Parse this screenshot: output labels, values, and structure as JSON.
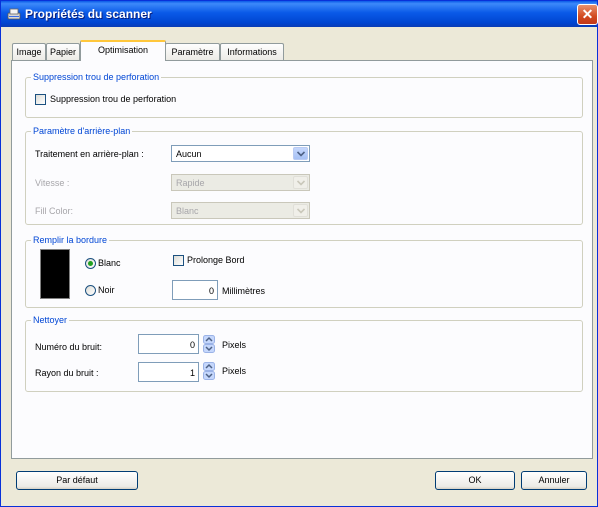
{
  "window": {
    "title": "Propriétés du scanner",
    "close_symbol": "✕"
  },
  "tabs": [
    {
      "label": "Image",
      "active": false
    },
    {
      "label": "Papier",
      "active": false
    },
    {
      "label": "Optimisation",
      "active": true
    },
    {
      "label": "Paramètre",
      "active": false
    },
    {
      "label": "Informations",
      "active": false
    }
  ],
  "hole_removal": {
    "title": "Suppression trou de perforation",
    "checkbox_label": "Suppression trou de perforation",
    "checked": false
  },
  "background": {
    "title": "Paramètre d'arrière-plan",
    "treatment_label": "Traitement en arrière-plan :",
    "treatment_value": "Aucun",
    "speed_label": "Vitesse :",
    "speed_value": "Rapide",
    "fill_label": "Fill Color:",
    "fill_value": "Blanc"
  },
  "border": {
    "title": "Remplir la bordure",
    "white_label": "Blanc",
    "white_selected": true,
    "black_label": "Noir",
    "black_selected": false,
    "extend_label": "Prolonge Bord",
    "extend_checked": false,
    "mm_value": "0",
    "mm_label": "Millimètres"
  },
  "clean": {
    "title": "Nettoyer",
    "noise_number_label": "Numéro du bruit:",
    "noise_number_value": "0",
    "noise_radius_label": "Rayon du bruit :",
    "noise_radius_value": "1",
    "unit_label": "Pixels"
  },
  "buttons": {
    "default_label": "Par défaut",
    "ok_label": "OK",
    "cancel_label": "Annuler"
  },
  "colors": {
    "group_title": "#0046d5",
    "titlebar": "#0a5ae8",
    "close": "#d24a1f",
    "tab_highlight": "#ffc73c"
  }
}
